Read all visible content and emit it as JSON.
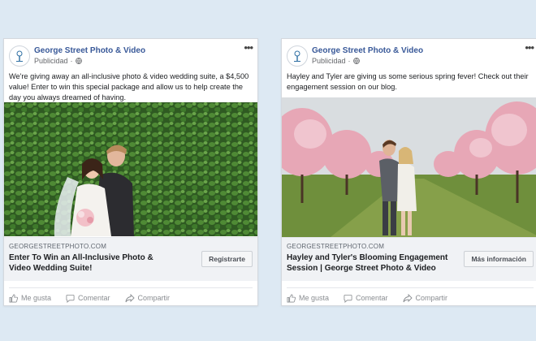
{
  "posts": [
    {
      "page_name": "George Street Photo & Video",
      "sponsored": "Publicidad",
      "caption": "We're giving away an all-inclusive photo & video wedding suite, a $4,500 value! Enter to win this special package and allow us to help create the day you always dreamed of having.",
      "domain": "GEORGESTREETPHOTO.COM",
      "headline": "Enter To Win an All-Inclusive Photo & Video Wedding Suite!",
      "cta": "Registrarte",
      "actions": {
        "like": "Me gusta",
        "comment": "Comentar",
        "share": "Compartir"
      }
    },
    {
      "page_name": "George Street Photo & Video",
      "sponsored": "Publicidad",
      "caption": "Hayley and Tyler are giving us some serious spring fever! Check out their engagement session on our blog.",
      "domain": "GEORGESTREETPHOTO.COM",
      "headline": "Hayley and Tyler's Blooming Engagement Session | George Street Photo & Video",
      "cta": "Más información",
      "actions": {
        "like": "Me gusta",
        "comment": "Comentar",
        "share": "Compartir"
      }
    }
  ],
  "colors": {
    "page_bg": "#dde9f3",
    "link_blue": "#385898",
    "link_bar": "#f0f2f5"
  }
}
